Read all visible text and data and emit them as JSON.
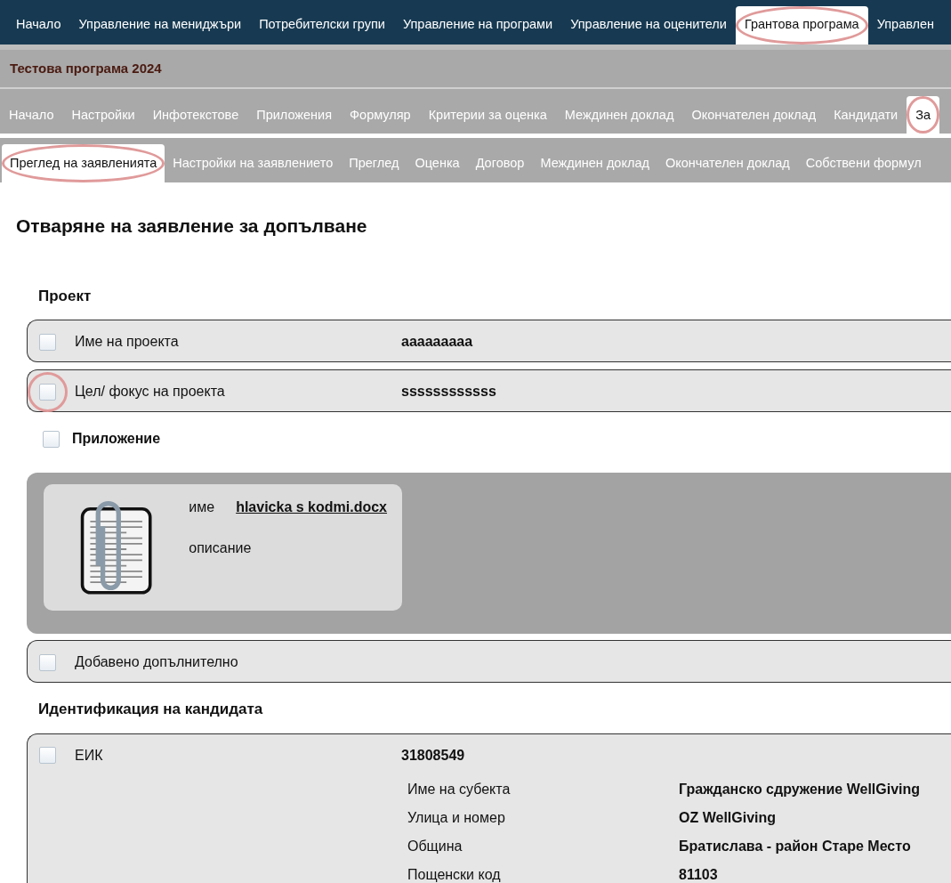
{
  "top_nav": [
    {
      "label": "Начало",
      "selected": false,
      "highlighted": false
    },
    {
      "label": "Управление на мениджъри",
      "selected": false,
      "highlighted": false
    },
    {
      "label": "Потребителски групи",
      "selected": false,
      "highlighted": false
    },
    {
      "label": "Управление на програми",
      "selected": false,
      "highlighted": false
    },
    {
      "label": "Управление на оценители",
      "selected": false,
      "highlighted": false
    },
    {
      "label": "Грантова програма",
      "selected": true,
      "highlighted": true
    },
    {
      "label": "Управлен",
      "selected": false,
      "highlighted": false
    }
  ],
  "program_title": "Тестова програма 2024",
  "program_nav": [
    {
      "label": "Начало",
      "selected": false,
      "highlighted": false
    },
    {
      "label": "Настройки",
      "selected": false,
      "highlighted": false
    },
    {
      "label": "Инфотекстове",
      "selected": false,
      "highlighted": false
    },
    {
      "label": "Приложения",
      "selected": false,
      "highlighted": false
    },
    {
      "label": "Формуляр",
      "selected": false,
      "highlighted": false
    },
    {
      "label": "Критерии за оценка",
      "selected": false,
      "highlighted": false
    },
    {
      "label": "Междинен доклад",
      "selected": false,
      "highlighted": false
    },
    {
      "label": "Окончателен доклад",
      "selected": false,
      "highlighted": false
    },
    {
      "label": "Кандидати",
      "selected": false,
      "highlighted": false
    },
    {
      "label": "За",
      "selected": true,
      "highlighted": true
    }
  ],
  "section_tabs": [
    {
      "label": "Преглед на заявленията",
      "selected": true,
      "highlighted": true
    },
    {
      "label": "Настройки на заявлението",
      "selected": false,
      "highlighted": false
    },
    {
      "label": "Преглед",
      "selected": false,
      "highlighted": false
    },
    {
      "label": "Оценка",
      "selected": false,
      "highlighted": false
    },
    {
      "label": "Договор",
      "selected": false,
      "highlighted": false
    },
    {
      "label": "Междинен доклад",
      "selected": false,
      "highlighted": false
    },
    {
      "label": "Окончателен доклад",
      "selected": false,
      "highlighted": false
    },
    {
      "label": "Собствени формул",
      "selected": false,
      "highlighted": false
    }
  ],
  "page_title": "Отваряне на заявление за допълване",
  "sections": [
    {
      "title": "Проект",
      "items": [
        {
          "kind": "field",
          "label": "Име на проекта",
          "value": "aaaaaaaaa",
          "checked": false,
          "highlighted": false
        },
        {
          "kind": "field",
          "label": "Цел/ фокус на проекта",
          "value": "ssssssssssss",
          "checked": false,
          "highlighted": true
        },
        {
          "kind": "attachment",
          "label": "Приложение",
          "checked": false,
          "highlighted": false,
          "name_label": "име",
          "file_name": "hlavicka s kodmi.docx",
          "description_label": "описание"
        },
        {
          "kind": "field",
          "label": "Добавено допълнително",
          "checked": false,
          "highlighted": false
        }
      ]
    },
    {
      "title": "Идентификация на кандидата",
      "items": [
        {
          "kind": "field",
          "label": "ЕИК",
          "value": "31808549",
          "checked": false,
          "highlighted": false,
          "details": [
            {
              "label": "Име на субекта",
              "value": "Гражданско сдружение WellGiving"
            },
            {
              "label": "Улица и номер",
              "value": "OZ WellGiving"
            },
            {
              "label": "Община",
              "value": "Братислава - район Старе Место"
            },
            {
              "label": "Пощенски код",
              "value": "81103"
            }
          ]
        }
      ]
    }
  ]
}
